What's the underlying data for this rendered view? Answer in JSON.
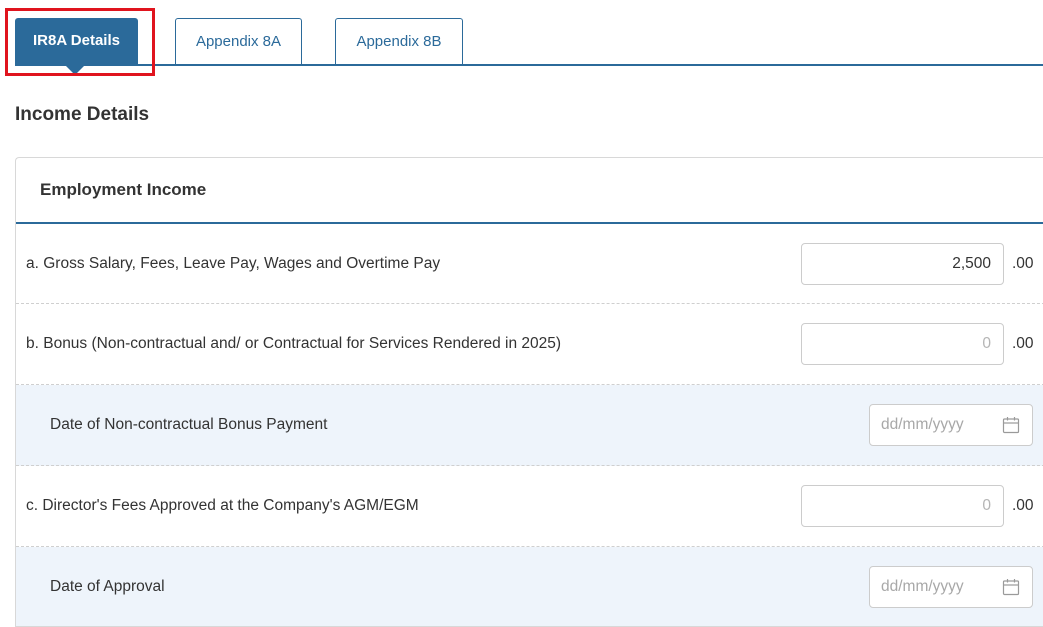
{
  "tabs": [
    {
      "label": "IR8A Details",
      "active": true
    },
    {
      "label": "Appendix 8A",
      "active": false
    },
    {
      "label": "Appendix 8B",
      "active": false
    }
  ],
  "section_title": "Income Details",
  "card": {
    "title": "Employment Income",
    "rows": [
      {
        "label": "a. Gross Salary, Fees, Leave Pay, Wages and Overtime Pay",
        "value": "2,500",
        "placeholder": "0",
        "suffix": ".00"
      },
      {
        "label": "b. Bonus (Non-contractual and/ or Contractual for Services Rendered in 2025)",
        "value": "",
        "placeholder": "0",
        "suffix": ".00"
      },
      {
        "label": "Date of Non-contractual Bonus Payment",
        "placeholder": "dd/mm/yyyy"
      },
      {
        "label": "c. Director's Fees Approved at the Company's AGM/EGM",
        "value": "",
        "placeholder": "0",
        "suffix": ".00"
      },
      {
        "label": "Date of Approval",
        "placeholder": "dd/mm/yyyy"
      }
    ]
  },
  "icons": {
    "calendar": "calendar-icon",
    "tab_pointer": "caret-down"
  },
  "colors": {
    "accent": "#2b6a9a",
    "highlight": "#e0141e",
    "shaded_row": "#eef4fb"
  }
}
